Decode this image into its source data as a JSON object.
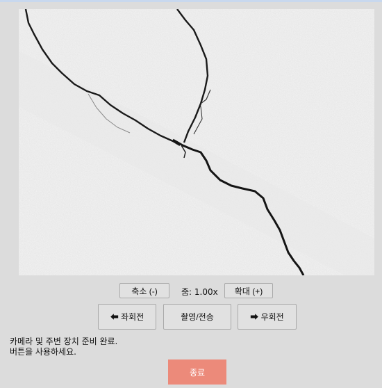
{
  "image": {
    "subject": "concrete-surface-crack"
  },
  "zoom": {
    "out_label": "축소 (-)",
    "value_label": "줌: 1.00x",
    "in_label": "확대 (+)"
  },
  "actions": {
    "rotate_left_label": "⬅ 좌회전",
    "capture_label": "촬영/전송",
    "rotate_right_label": "➡ 우회전"
  },
  "status": {
    "line1": "카메라 및 주변 장치 준비 완료.",
    "line2": "버튼을 사용하세요."
  },
  "exit": {
    "label": "종료",
    "color": "#ec8a7a"
  }
}
